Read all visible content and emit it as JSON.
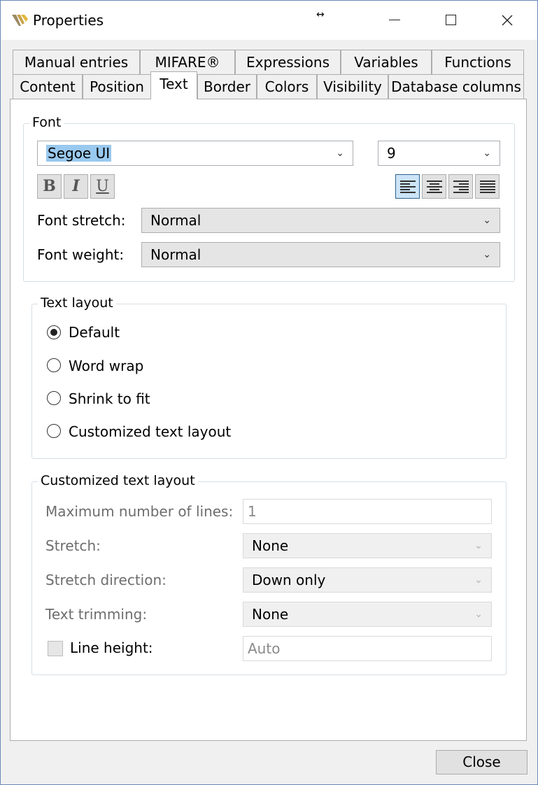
{
  "window": {
    "title": "Properties",
    "resize_glyph": "↔",
    "close_glyph": "✕"
  },
  "tabs": {
    "row1": [
      "Manual entries",
      "MIFARE®",
      "Expressions",
      "Variables",
      "Functions"
    ],
    "row2": [
      "Content",
      "Position",
      "Text",
      "Border",
      "Colors",
      "Visibility",
      "Database columns"
    ],
    "active": "Text"
  },
  "font_group": {
    "title": "Font",
    "family": "Segoe UI",
    "size": "9",
    "bold": "B",
    "italic": "I",
    "underline": "U",
    "alignment": "left",
    "stretch_label": "Font stretch:",
    "stretch_value": "Normal",
    "weight_label": "Font weight:",
    "weight_value": "Normal"
  },
  "text_layout": {
    "title": "Text layout",
    "options": [
      "Default",
      "Word wrap",
      "Shrink to fit",
      "Customized text layout"
    ],
    "selected": "Default"
  },
  "custom_layout": {
    "title": "Customized text layout",
    "max_lines_label": "Maximum number of lines:",
    "max_lines_value": "1",
    "stretch_label": "Stretch:",
    "stretch_value": "None",
    "direction_label": "Stretch direction:",
    "direction_value": "Down only",
    "trimming_label": "Text trimming:",
    "trimming_value": "None",
    "line_height_label": "Line height:",
    "line_height_value": "Auto"
  },
  "footer": {
    "close_label": "Close"
  },
  "colors": {
    "accent": "#0078d7",
    "selection": "#99c9ef"
  }
}
